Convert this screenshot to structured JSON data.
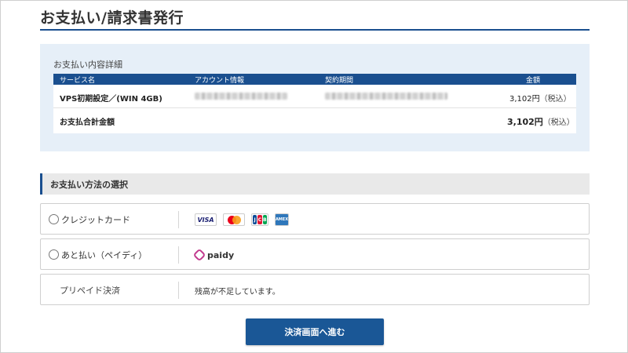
{
  "page": {
    "title": "お支払い/請求書発行"
  },
  "details": {
    "heading": "お支払い内容詳細",
    "columns": [
      "サービス名",
      "アカウント情報",
      "契約期間",
      "金額"
    ],
    "rows": [
      {
        "service": "VPS初期設定／(WIN 4GB)",
        "amount": "3,102円",
        "tax": "（税込）"
      }
    ],
    "total": {
      "label": "お支払合計金額",
      "amount": "3,102円",
      "tax": "（税込）"
    }
  },
  "methods": {
    "heading": "お支払い方法の選択",
    "items": [
      {
        "label": "クレジットカード",
        "brands": [
          "VISA",
          "Mastercard",
          "JCB",
          "AMEX"
        ]
      },
      {
        "label": "あと払い（ペイディ）",
        "brand": "paidy"
      },
      {
        "label": "プリペイド決済",
        "note": "残高が不足しています。"
      }
    ]
  },
  "submit": {
    "label": "決済画面へ進む"
  },
  "colors": {
    "brand_blue": "#1a4f8f",
    "panel_bg": "#e6eff8",
    "paidy_magenta": "#c23a8e"
  }
}
